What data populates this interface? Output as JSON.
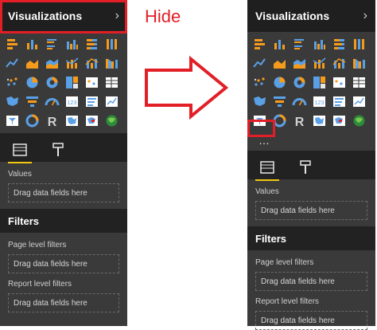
{
  "left": {
    "title": "Visualizations",
    "values_label": "Values",
    "drop_text": "Drag data fields here",
    "filters_title": "Filters",
    "page_filters": "Page level filters",
    "report_filters": "Report level filters"
  },
  "right": {
    "title": "Visualizations",
    "values_label": "Values",
    "drop_text": "Drag data fields here",
    "filters_title": "Filters",
    "page_filters": "Page level filters",
    "report_filters": "Report level filters",
    "more_label": "…"
  },
  "annotation": {
    "hide": "Hide"
  },
  "colors": {
    "accent": "#f2c811",
    "red": "#e21f26",
    "panel": "#3a3a3a",
    "header": "#1f1f1f"
  },
  "icons": [
    "stacked-bar-icon",
    "stacked-column-icon",
    "clustered-bar-icon",
    "clustered-column-icon",
    "100pct-bar-icon",
    "100pct-column-icon",
    "line-chart-icon",
    "area-chart-icon",
    "stacked-area-icon",
    "line-column-icon",
    "line-column2-icon",
    "ribbon-icon",
    "scatter-icon",
    "pie-icon",
    "donut-icon",
    "treemap-icon",
    "map-icon",
    "table-icon",
    "filled-map-icon",
    "funnel-icon",
    "gauge-icon",
    "card-icon",
    "multirow-card-icon",
    "kpi-icon",
    "slicer-icon",
    "waterfall-icon",
    "r-visual-icon",
    "shape-map-icon",
    "globe-icon",
    "arcgis-icon"
  ]
}
